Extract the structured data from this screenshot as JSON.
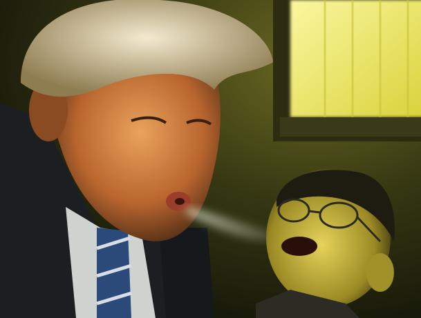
{
  "image": {
    "kind": "photo-composite",
    "palette": {
      "background": "#3a3b17",
      "window_glow": "#f4f07a",
      "skin_warm": "#d88a4a",
      "skin_yellow": "#c9b53a",
      "hair_blonde": "#e9d9a8",
      "suit": "#1b1f22",
      "tie": "#2b4a7a"
    }
  }
}
